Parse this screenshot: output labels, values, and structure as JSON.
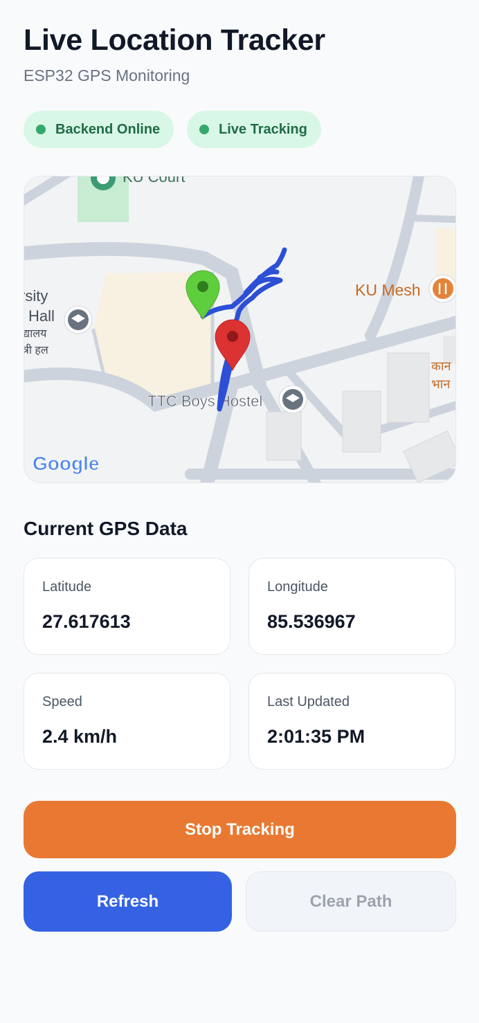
{
  "header": {
    "title": "Live Location Tracker",
    "subtitle": "ESP32 GPS Monitoring"
  },
  "status": {
    "backend": "Backend Online",
    "tracking": "Live Tracking",
    "color": "#34a86b"
  },
  "map": {
    "labels": {
      "court": "KU Court",
      "hall_1": "rsity",
      "hall_2": "Hall",
      "hall_hi_1": "द्यालय",
      "hall_hi_2": "त्री हल",
      "mesh": "KU Mesh",
      "hostel": "TTC Boys Hostel",
      "right_hi_1": "कान",
      "right_hi_2": "भान",
      "brand": "Google"
    },
    "path_color": "#2c4fd6",
    "start_marker_color": "#5fce3d",
    "end_marker_color": "#dd3232"
  },
  "gps": {
    "section_title": "Current GPS Data",
    "latitude_label": "Latitude",
    "latitude": "27.617613",
    "longitude_label": "Longitude",
    "longitude": "85.536967",
    "speed_label": "Speed",
    "speed": "2.4 km/h",
    "updated_label": "Last Updated",
    "updated": "2:01:35 PM"
  },
  "actions": {
    "stop": "Stop Tracking",
    "refresh": "Refresh",
    "clear": "Clear Path",
    "stop_color": "#e97932",
    "refresh_color": "#3562e3"
  }
}
